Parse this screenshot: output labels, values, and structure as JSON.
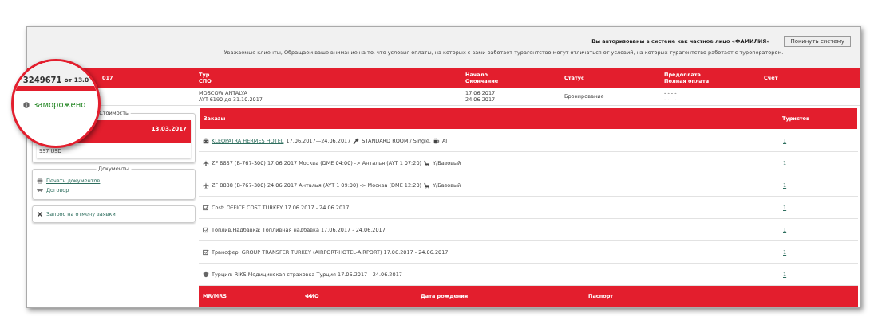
{
  "notice": {
    "auth": "Вы авторизованы в системе как частное лицо «ФАМИЛИЯ»",
    "logout": "Покинуть систему",
    "message": "Уважаемые клиенты, Обращаем ваше внимание на то, что условия оплаты, на которых с вами работает турагентство могут отличаться от условий, на которых турагентство работает с туроператором."
  },
  "magnifier": {
    "order_number": "3249671",
    "order_date": "от 13.0",
    "status": "заморожено"
  },
  "header": {
    "column_1": "017",
    "tour": [
      "Тур",
      "СПО"
    ],
    "dates": [
      "Начало",
      "Окончание"
    ],
    "status": "Статус",
    "payment": [
      "Предоплата",
      "Полная оплата"
    ],
    "invoice": "Счет"
  },
  "tour_row": {
    "tour": [
      "MOSCOW ANTALYA",
      "AYT-6190 до 31.10.2017"
    ],
    "dates": [
      "17.06.2017",
      "24.06.2017"
    ],
    "status": "Бронирование",
    "payment": [
      "- - - -",
      "- - - -"
    ]
  },
  "cost": {
    "legend": "Стоимость",
    "date": "13.03.2017",
    "amount": "557 USD"
  },
  "documents": {
    "legend": "Документы",
    "links": [
      "Печать документов",
      "Договор"
    ]
  },
  "cancel": {
    "link": "Запрос на отмену заявки"
  },
  "orders": {
    "title": "Заказы",
    "tourists_title": "Туристов",
    "rows": [
      {
        "kind": "hotel",
        "link": "KLEOPATRA HERMES HOTEL",
        "text": "17.06.2017—24.06.2017",
        "room": "STANDARD ROOM / Single,",
        "meal": "AI",
        "tourists": "1"
      },
      {
        "kind": "flight",
        "text": "ZF 8887 (B-767-300) 17.06.2017 Москва (DME 04:00) -> Анталья (AYT 1 07:20)",
        "fare": "Y/Базовый",
        "tourists": "1"
      },
      {
        "kind": "flight",
        "text": "ZF 8888 (B-767-300) 24.06.2017 Анталья (AYT 1 09:00) -> Москва (DME 12:20)",
        "fare": "Y/Базовый",
        "tourists": "1"
      },
      {
        "kind": "service",
        "text": "Cost: OFFICE COST TURKEY 17.06.2017 - 24.06.2017",
        "tourists": "1"
      },
      {
        "kind": "service",
        "text": "Топлив.Надбавка: Топливная надбавка 17.06.2017 - 24.06.2017",
        "tourists": "1"
      },
      {
        "kind": "service",
        "text": "Трансфер: GROUP TRANSFER TURKEY (AIRPORT-HOTEL-AIRPORT) 17.06.2017 - 24.06.2017",
        "tourists": "1"
      },
      {
        "kind": "insurance",
        "text": "Турция: RIKS Медицинская страховка Турция 17.06.2017 - 24.06.2017",
        "tourists": "1"
      }
    ]
  },
  "tourists_header": [
    "MR/MRS",
    "ФИО",
    "Дата рождения",
    "Паспорт"
  ]
}
